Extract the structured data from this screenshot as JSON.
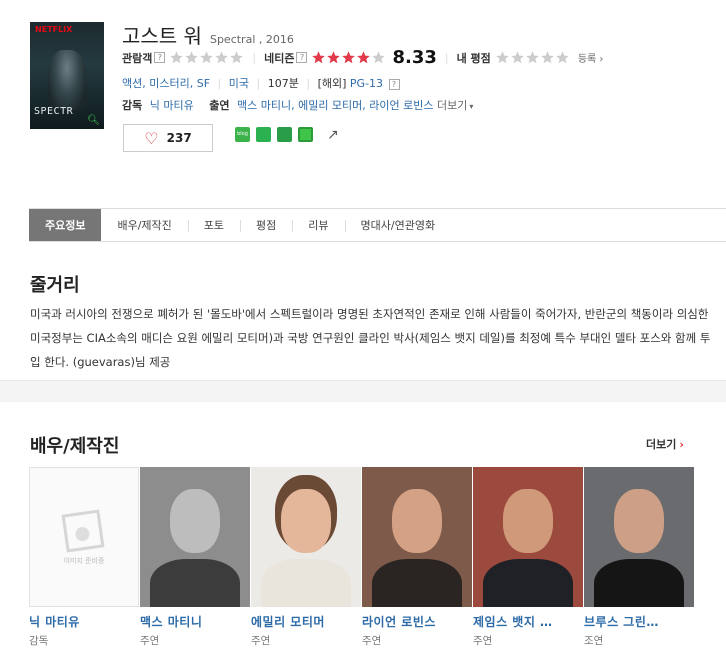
{
  "movie": {
    "poster_badge": "NETFLIX",
    "poster_title": "SPECTR",
    "title_ko": "고스트 워",
    "title_en": "Spectral , 2016"
  },
  "ratings": {
    "audience_label": "관람객",
    "netizen_label": "네티즌",
    "netizen_score": "8.33",
    "netizen_stars": 4,
    "my_label": "내 평점",
    "register": "등록",
    "help_icon_text": "?"
  },
  "info": {
    "genres": [
      "액션",
      "미스터리",
      "SF"
    ],
    "country": "미국",
    "runtime": "107분",
    "overseas": "[해외]",
    "grade": "PG-13",
    "director_label": "감독",
    "director": "닉 마티유",
    "cast_label": "출연",
    "cast_list": "맥스 마티니, 에밀리 모티머, 라이언 로빈스",
    "more": "더보기"
  },
  "actions": {
    "like_count": "237",
    "blog_icon_text": "blog"
  },
  "tabs": [
    "주요정보",
    "배우/제작진",
    "포토",
    "평점",
    "리뷰",
    "명대사/연관영화"
  ],
  "plot": {
    "heading": "줄거리",
    "text": "미국과 러시아의 전쟁으로 폐허가 된 '몰도바'에서 스펙트럴이라 명명된 초자연적인 존재로 인해 사람들이 죽어가자, 반란군의 책동이라 의심한 미국정부는 CIA소속의 매디슨 요원 에밀리 모티머)과 국방 연구원인 클라인 박사(제임스 뱃지 데일)를 최정예 특수 부대인 델타 포스와 함께 투입 한다. (guevaras)님 제공"
  },
  "cast_section": {
    "heading": "배우/제작진",
    "more": "더보기",
    "no_image": "이미지 준비중",
    "people": [
      {
        "name": "닉 마티유",
        "role": "감독"
      },
      {
        "name": "맥스 마티니",
        "role": "주연"
      },
      {
        "name": "에밀리 모티머",
        "role": "주연"
      },
      {
        "name": "라이언 로빈스",
        "role": "주연"
      },
      {
        "name": "제임스 뱃지 …",
        "role": "주연"
      },
      {
        "name": "브루스 그린…",
        "role": "조연"
      }
    ]
  },
  "colors": {
    "star_active": "#e13b4b",
    "star_inactive": "#cccccc",
    "link": "#2c6aa8",
    "tab_active": "#767676"
  }
}
